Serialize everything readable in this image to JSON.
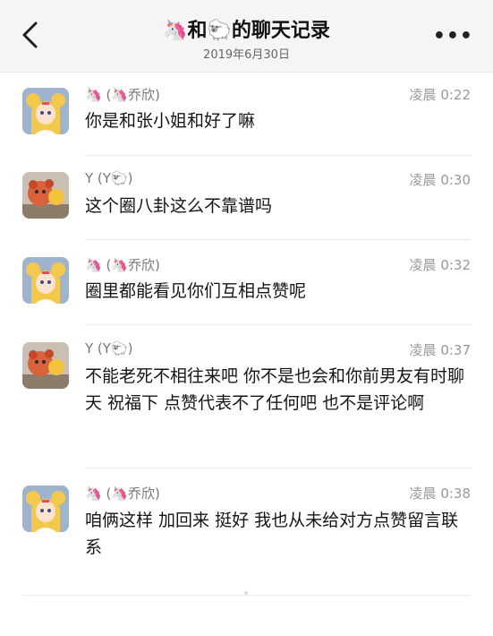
{
  "header": {
    "title": "🦄和🐑的聊天记录",
    "date": "2019年6月30日",
    "back_icon": "chevron-left-icon",
    "more_label": "•••"
  },
  "messages": [
    {
      "sender": "🦄 (🦄乔欣)",
      "time": "凌晨 0:22",
      "text": "你是和张小姐和好了嘛",
      "avatar": "sailor-moon-avatar"
    },
    {
      "sender": "Y (Y🐑)",
      "time": "凌晨 0:30",
      "text": "这个圈八卦这么不靠谱吗",
      "avatar": "plush-toy-avatar"
    },
    {
      "sender": "🦄 (🦄乔欣)",
      "time": "凌晨 0:32",
      "text": "圈里都能看见你们互相点赞呢",
      "avatar": "sailor-moon-avatar"
    },
    {
      "sender": "Y (Y🐑)",
      "time": "凌晨 0:37",
      "text": "不能老死不相往来吧 你不是也会和你前男友有时聊天 祝福下 点赞代表不了任何吧 也不是评论啊",
      "avatar": "plush-toy-avatar"
    },
    {
      "sender": "🦄 (🦄乔欣)",
      "time": "凌晨 0:38",
      "text": "咱俩这样 加回来 挺好  我也从未给对方点赞留言联系",
      "avatar": "sailor-moon-avatar"
    }
  ]
}
